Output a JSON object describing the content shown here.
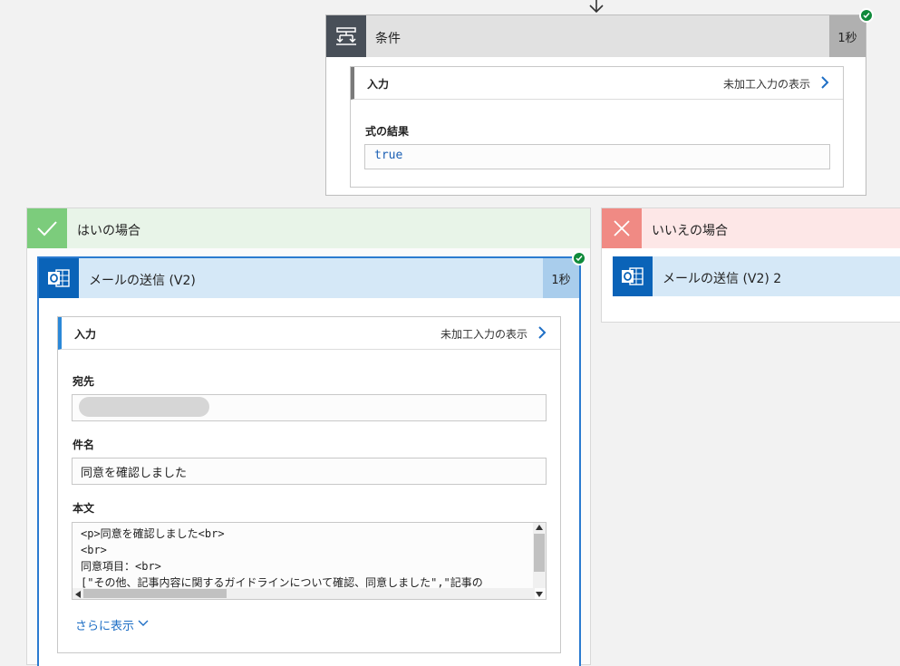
{
  "condition": {
    "title": "条件",
    "duration": "1秒",
    "inputs_label": "入力",
    "raw_inputs_link": "未加工入力の表示",
    "expression_label": "式の結果",
    "expression_value": "true"
  },
  "yes_branch": {
    "title": "はいの場合",
    "action": {
      "title": "メールの送信 (V2)",
      "duration": "1秒",
      "inputs_label": "入力",
      "raw_inputs_link": "未加工入力の表示",
      "to_label": "宛先",
      "subject_label": "件名",
      "subject_value": "同意を確認しました",
      "body_label": "本文",
      "body_lines": [
        "<p>同意を確認しました<br>",
        "<br>",
        "同意項目：<br>",
        "[\"その他、記事内容に関するガイドラインについて確認、同意しました\",\"記事の"
      ],
      "show_more": "さらに表示"
    }
  },
  "no_branch": {
    "title": "いいえの場合",
    "action": {
      "title": "メールの送信 (V2) 2"
    }
  },
  "colors": {
    "accent_blue": "#0a63b8",
    "success_green": "#0f8a3a",
    "yes_green": "#7ccc7c",
    "no_red": "#f08a84"
  }
}
